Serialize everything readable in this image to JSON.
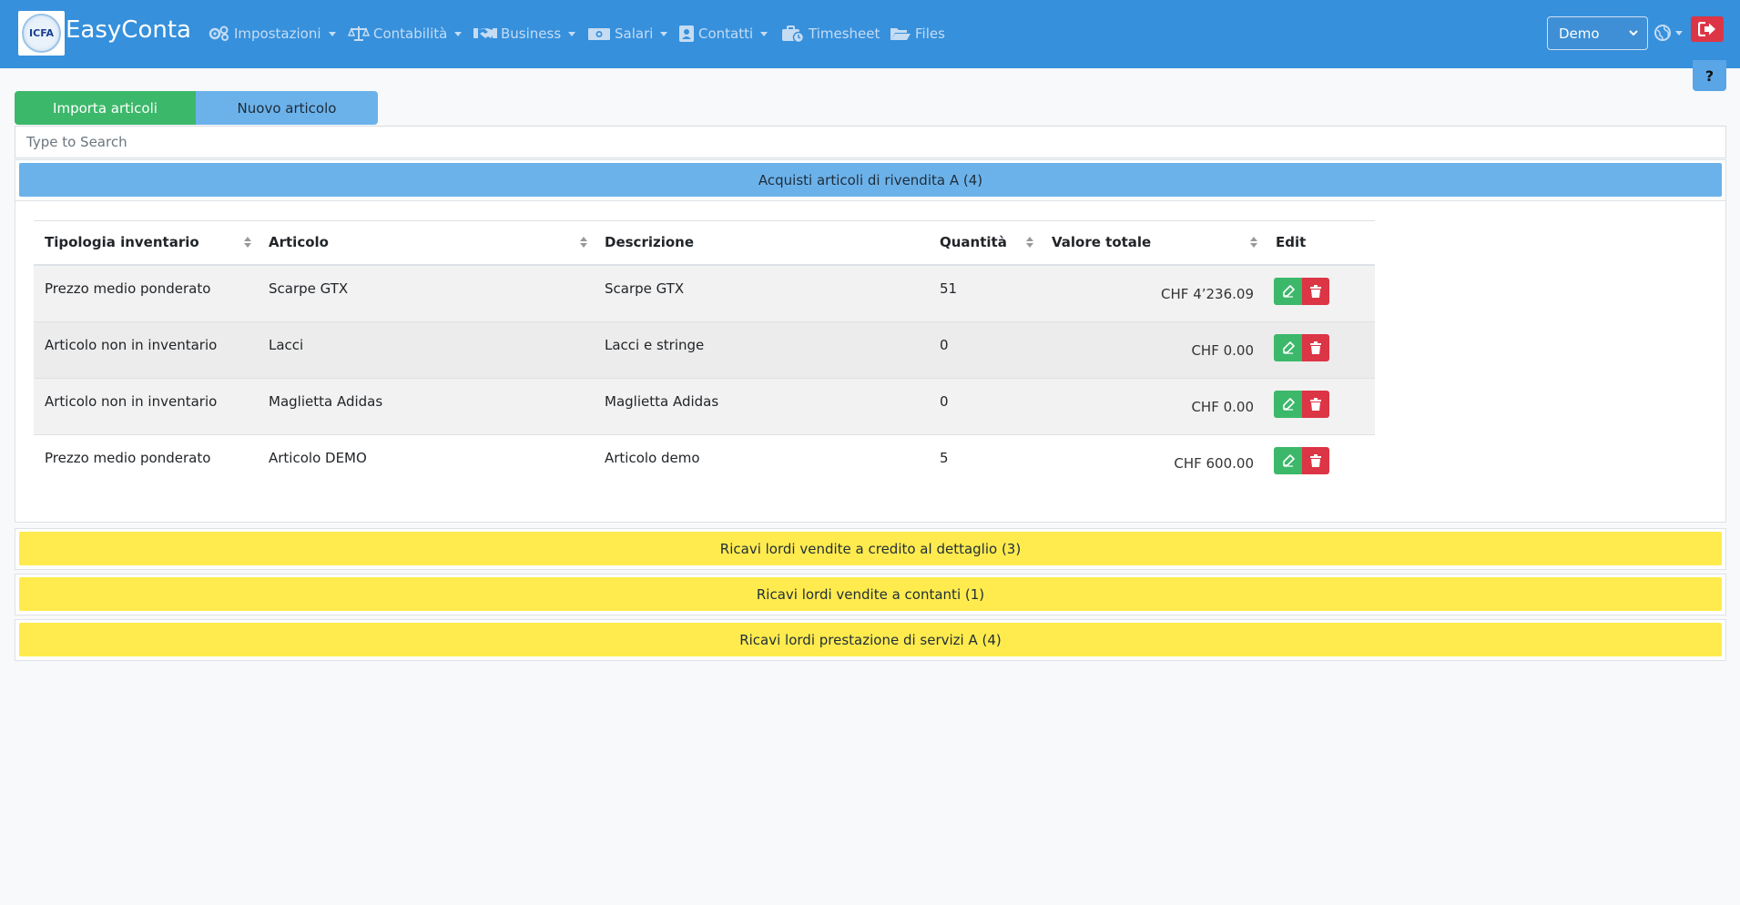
{
  "brand": {
    "name": "EasyConta",
    "logo_text": "ICFA"
  },
  "nav": {
    "items": [
      {
        "label": "Impostazioni",
        "icon": "gears-icon",
        "dropdown": true
      },
      {
        "label": "Contabilità",
        "icon": "balance-scale-icon",
        "dropdown": true
      },
      {
        "label": "Business",
        "icon": "handshake-icon",
        "dropdown": true
      },
      {
        "label": "Salari",
        "icon": "money-bill-icon",
        "dropdown": true
      },
      {
        "label": "Contatti",
        "icon": "address-book-icon",
        "dropdown": true
      },
      {
        "label": "Timesheet",
        "icon": "business-time-icon",
        "dropdown": false
      },
      {
        "label": "Files",
        "icon": "folder-open-icon",
        "dropdown": false
      }
    ],
    "company_select": {
      "value": "Demo"
    }
  },
  "help": {
    "label": "?"
  },
  "tabs": {
    "import_label": "Importa articoli",
    "new_label": "Nuovo articolo"
  },
  "search": {
    "placeholder": "Type to Search"
  },
  "sections": [
    {
      "title": "Acquisti articoli di rivendita A (4)"
    },
    {
      "title": "Ricavi lordi vendite a credito al dettaglio  (3)"
    },
    {
      "title": "Ricavi lordi vendite a contanti (1)"
    },
    {
      "title": "Ricavi lordi prestazione di servizi A (4)"
    }
  ],
  "table": {
    "headers": {
      "tipologia": "Tipologia inventario",
      "articolo": "Articolo",
      "descrizione": "Descrizione",
      "quantita": "Quantità",
      "valore": "Valore totale",
      "edit": "Edit"
    },
    "rows": [
      {
        "tipologia": "Prezzo medio ponderato",
        "articolo": "Scarpe GTX",
        "descrizione": "Scarpe GTX",
        "quantita": "51",
        "valore": "CHF 4’236.09"
      },
      {
        "tipologia": "Articolo non in inventario",
        "articolo": "Lacci",
        "descrizione": "Lacci e stringe",
        "quantita": "0",
        "valore": "CHF 0.00"
      },
      {
        "tipologia": "Articolo non in inventario",
        "articolo": "Maglietta Adidas",
        "descrizione": "Maglietta Adidas",
        "quantita": "0",
        "valore": "CHF 0.00"
      },
      {
        "tipologia": "Prezzo medio ponderato",
        "articolo": "Articolo DEMO",
        "descrizione": "Articolo demo",
        "quantita": "5",
        "valore": "CHF 600.00"
      }
    ]
  },
  "colors": {
    "navbar": "#3690dc",
    "success": "#3cb86a",
    "danger": "#dc3545",
    "info": "#6cb2ea",
    "warning": "#ffeb4d"
  }
}
